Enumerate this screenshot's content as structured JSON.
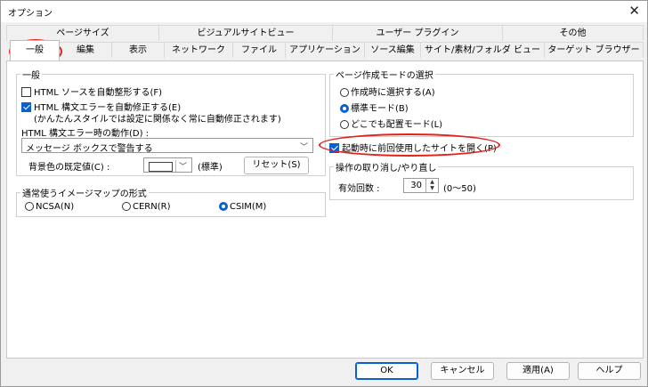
{
  "window": {
    "title": "オプション",
    "close_symbol": "✕"
  },
  "tabs": {
    "row1": [
      "ページサイズ",
      "ビジュアルサイトビュー",
      "ユーザー プラグイン",
      "その他"
    ],
    "row2": [
      "一般",
      "編集",
      "表示",
      "ネットワーク",
      "ファイル",
      "アプリケーション",
      "ソース編集",
      "サイト/素材/フォルダ ビュー",
      "ターゲット ブラウザー"
    ]
  },
  "general": {
    "legend": "一般",
    "auto_format_label": "HTML ソースを自動整形する(F)",
    "auto_fix_label": "HTML 構文エラーを自動修正する(E)",
    "auto_fix_note": "(かんたんスタイルでは設定に関係なく常に自動修正されます)",
    "error_action_label": "HTML 構文エラー時の動作(D) :",
    "error_action_value": "メッセージ ボックスで警告する",
    "bgcolor_label": "背景色の既定値(C) :",
    "bgcolor_default": "(標準)",
    "reset_label": "リセット(S)"
  },
  "imagemap": {
    "legend": "通常使うイメージマップの形式",
    "options": [
      "NCSA(N)",
      "CERN(R)",
      "CSIM(M)"
    ],
    "selected": "CSIM(M)"
  },
  "pagemode": {
    "legend": "ページ作成モードの選択",
    "options": [
      "作成時に選択する(A)",
      "標準モード(B)",
      "どこでも配置モード(L)"
    ],
    "selected": "標準モード(B)"
  },
  "open_last_site_label": "起動時に前回使用したサイトを開く(P)",
  "undo": {
    "legend": "操作の取り消し/やり直し",
    "count_label": "有効回数 :",
    "count_value": "30",
    "range_note": "(0〜50)"
  },
  "buttons": {
    "ok": "OK",
    "cancel": "キャンセル",
    "apply": "適用(A)",
    "help": "ヘルプ"
  },
  "colors": {
    "accent": "#0a5fd1",
    "annotation": "#e0231c"
  }
}
